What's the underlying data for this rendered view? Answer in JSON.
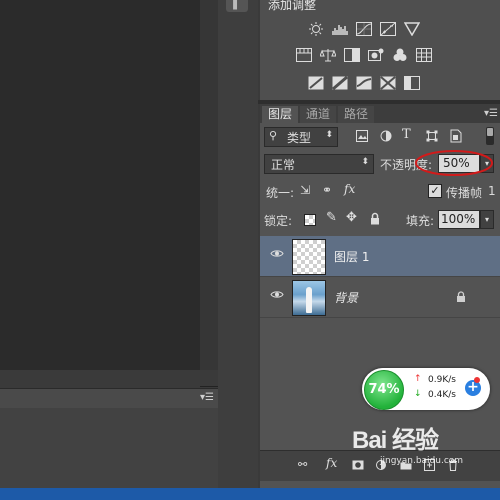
{
  "adjustments": {
    "title": "添加调整",
    "icons": [
      "brightness-icon",
      "levels-icon",
      "curves-icon",
      "exposure-icon",
      "vibrance-icon",
      "hue-saturation-icon",
      "color-balance-icon",
      "black-white-icon",
      "photo-filter-icon",
      "channel-mixer-icon",
      "color-lookup-icon",
      "invert-icon",
      "posterize-icon",
      "threshold-icon",
      "gradient-map-icon",
      "selective-color-icon"
    ]
  },
  "tabs": [
    "图层",
    "通道",
    "路径"
  ],
  "filter": {
    "kind_label": "类型"
  },
  "blend": {
    "mode": "正常",
    "opacity_label": "不透明度:",
    "opacity_value": "50%"
  },
  "unify": {
    "label": "统一:",
    "propagate_label": "传播帧",
    "propagate_value": "1"
  },
  "lock": {
    "label": "锁定:",
    "fill_label": "填充:",
    "fill_value": "100%"
  },
  "layers": [
    {
      "name": "图层 1",
      "selected": true
    },
    {
      "name": "背景",
      "locked": true
    }
  ],
  "net_widget": {
    "percent": "74%",
    "up": "0.9K/s",
    "down": "0.4K/s"
  },
  "watermark": {
    "main": "Bai  经验",
    "sub": "jingyan.baidu.com"
  },
  "colors": {
    "selected_row": "#5f6f85",
    "panel": "#535353",
    "opacity_highlight": "#d11a1a",
    "widget_green": "#22b23a"
  }
}
